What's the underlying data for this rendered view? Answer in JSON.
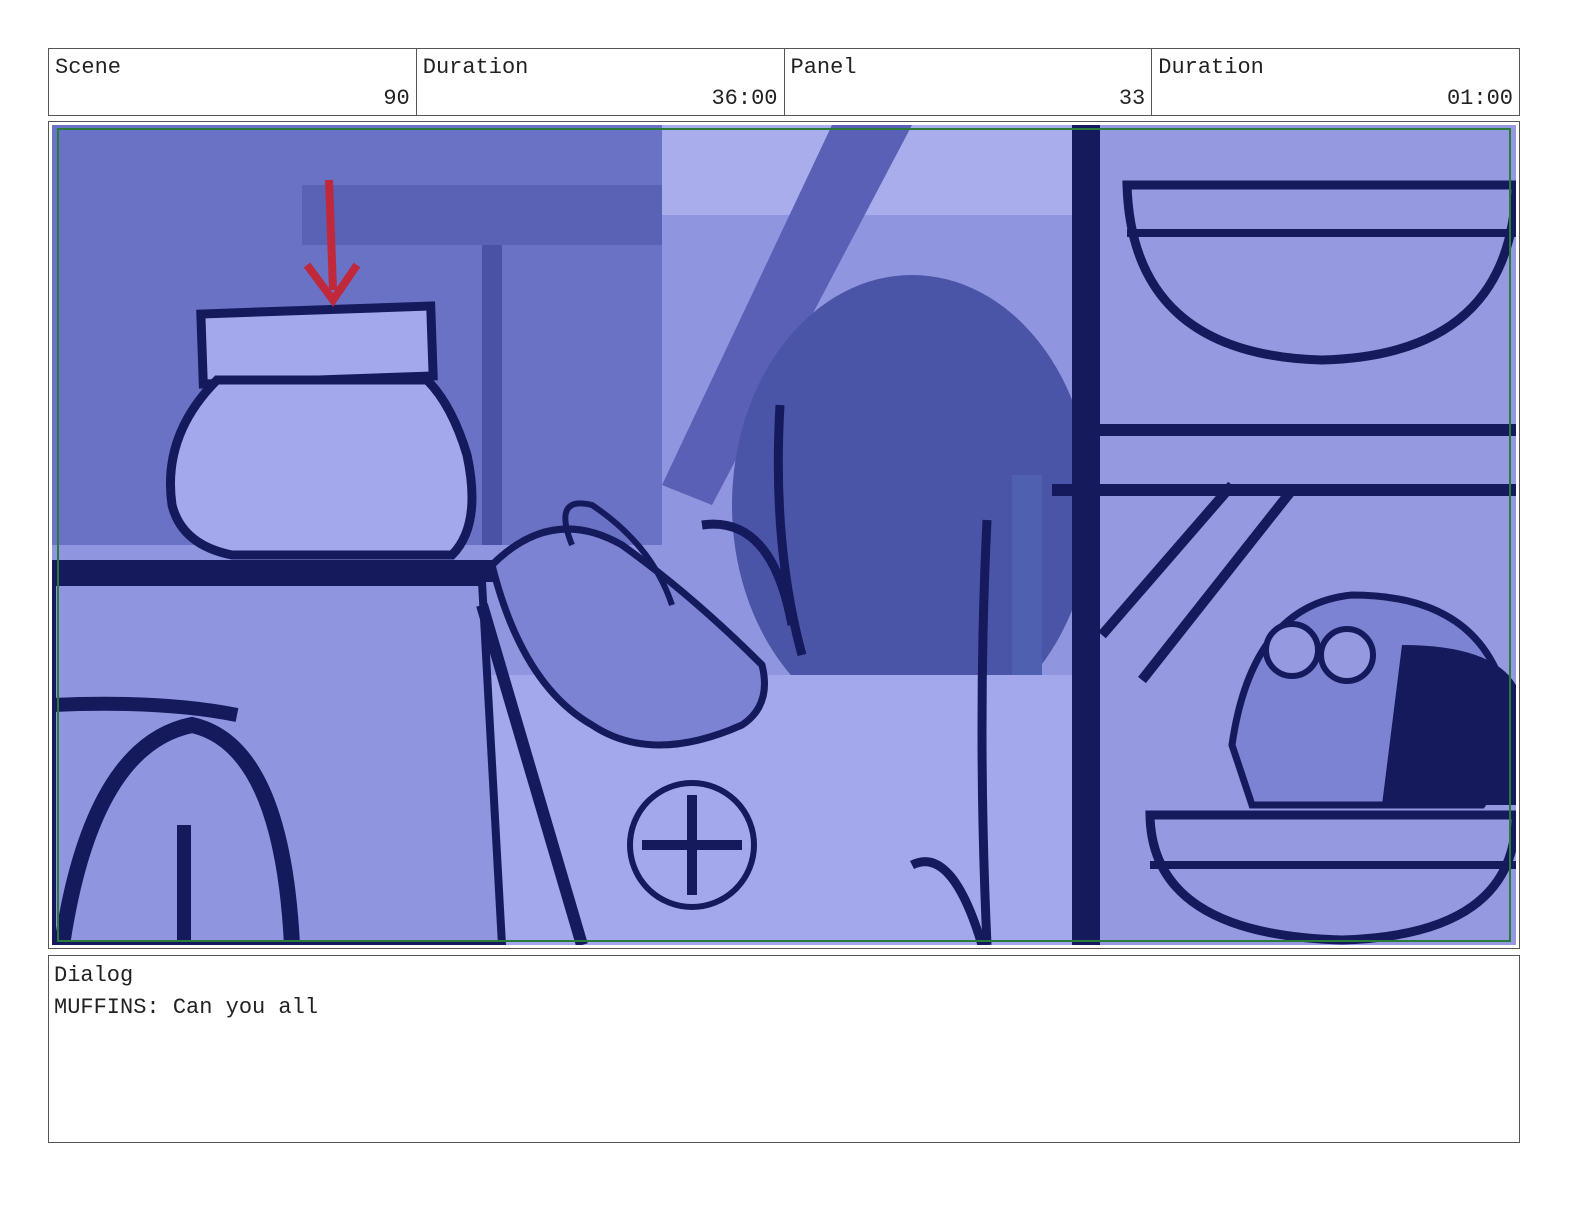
{
  "header": {
    "scene_label": "Scene",
    "scene_value": "90",
    "scene_duration_label": "Duration",
    "scene_duration_value": "36:00",
    "panel_label": "Panel",
    "panel_value": "33",
    "panel_duration_label": "Duration",
    "panel_duration_value": "01:00"
  },
  "dialog": {
    "label": "Dialog",
    "text": "MUFFINS: Can you all"
  },
  "colors": {
    "panel_tint": "#8f95de",
    "line_ink": "#141a5c",
    "safe_frame": "#2a7a3a",
    "arrow": "#c0283c"
  }
}
